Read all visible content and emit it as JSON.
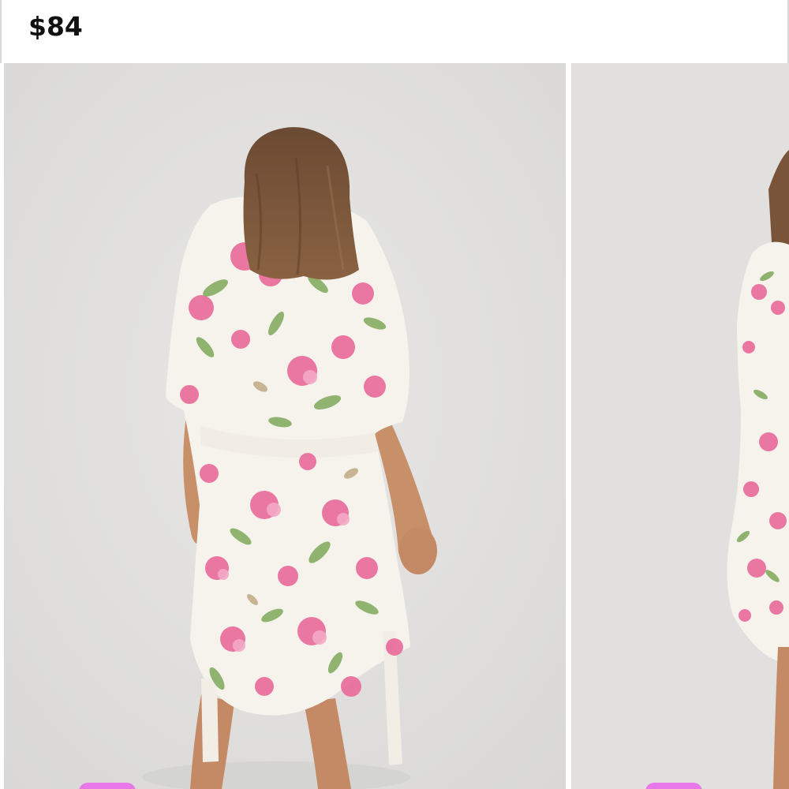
{
  "product": {
    "price": "$84"
  },
  "gallery": {
    "images": [
      {
        "name": "floral-robe-back-view"
      },
      {
        "name": "floral-robe-side-view"
      }
    ]
  },
  "colors": {
    "backdrop": "#e3e2e0",
    "robe": "#f7f4ee",
    "flower": "#e86a9a",
    "leaf": "#7ea85a",
    "hair": "#7a5438",
    "skin": "#c98f6a",
    "accent_pill": "#e678ea"
  }
}
